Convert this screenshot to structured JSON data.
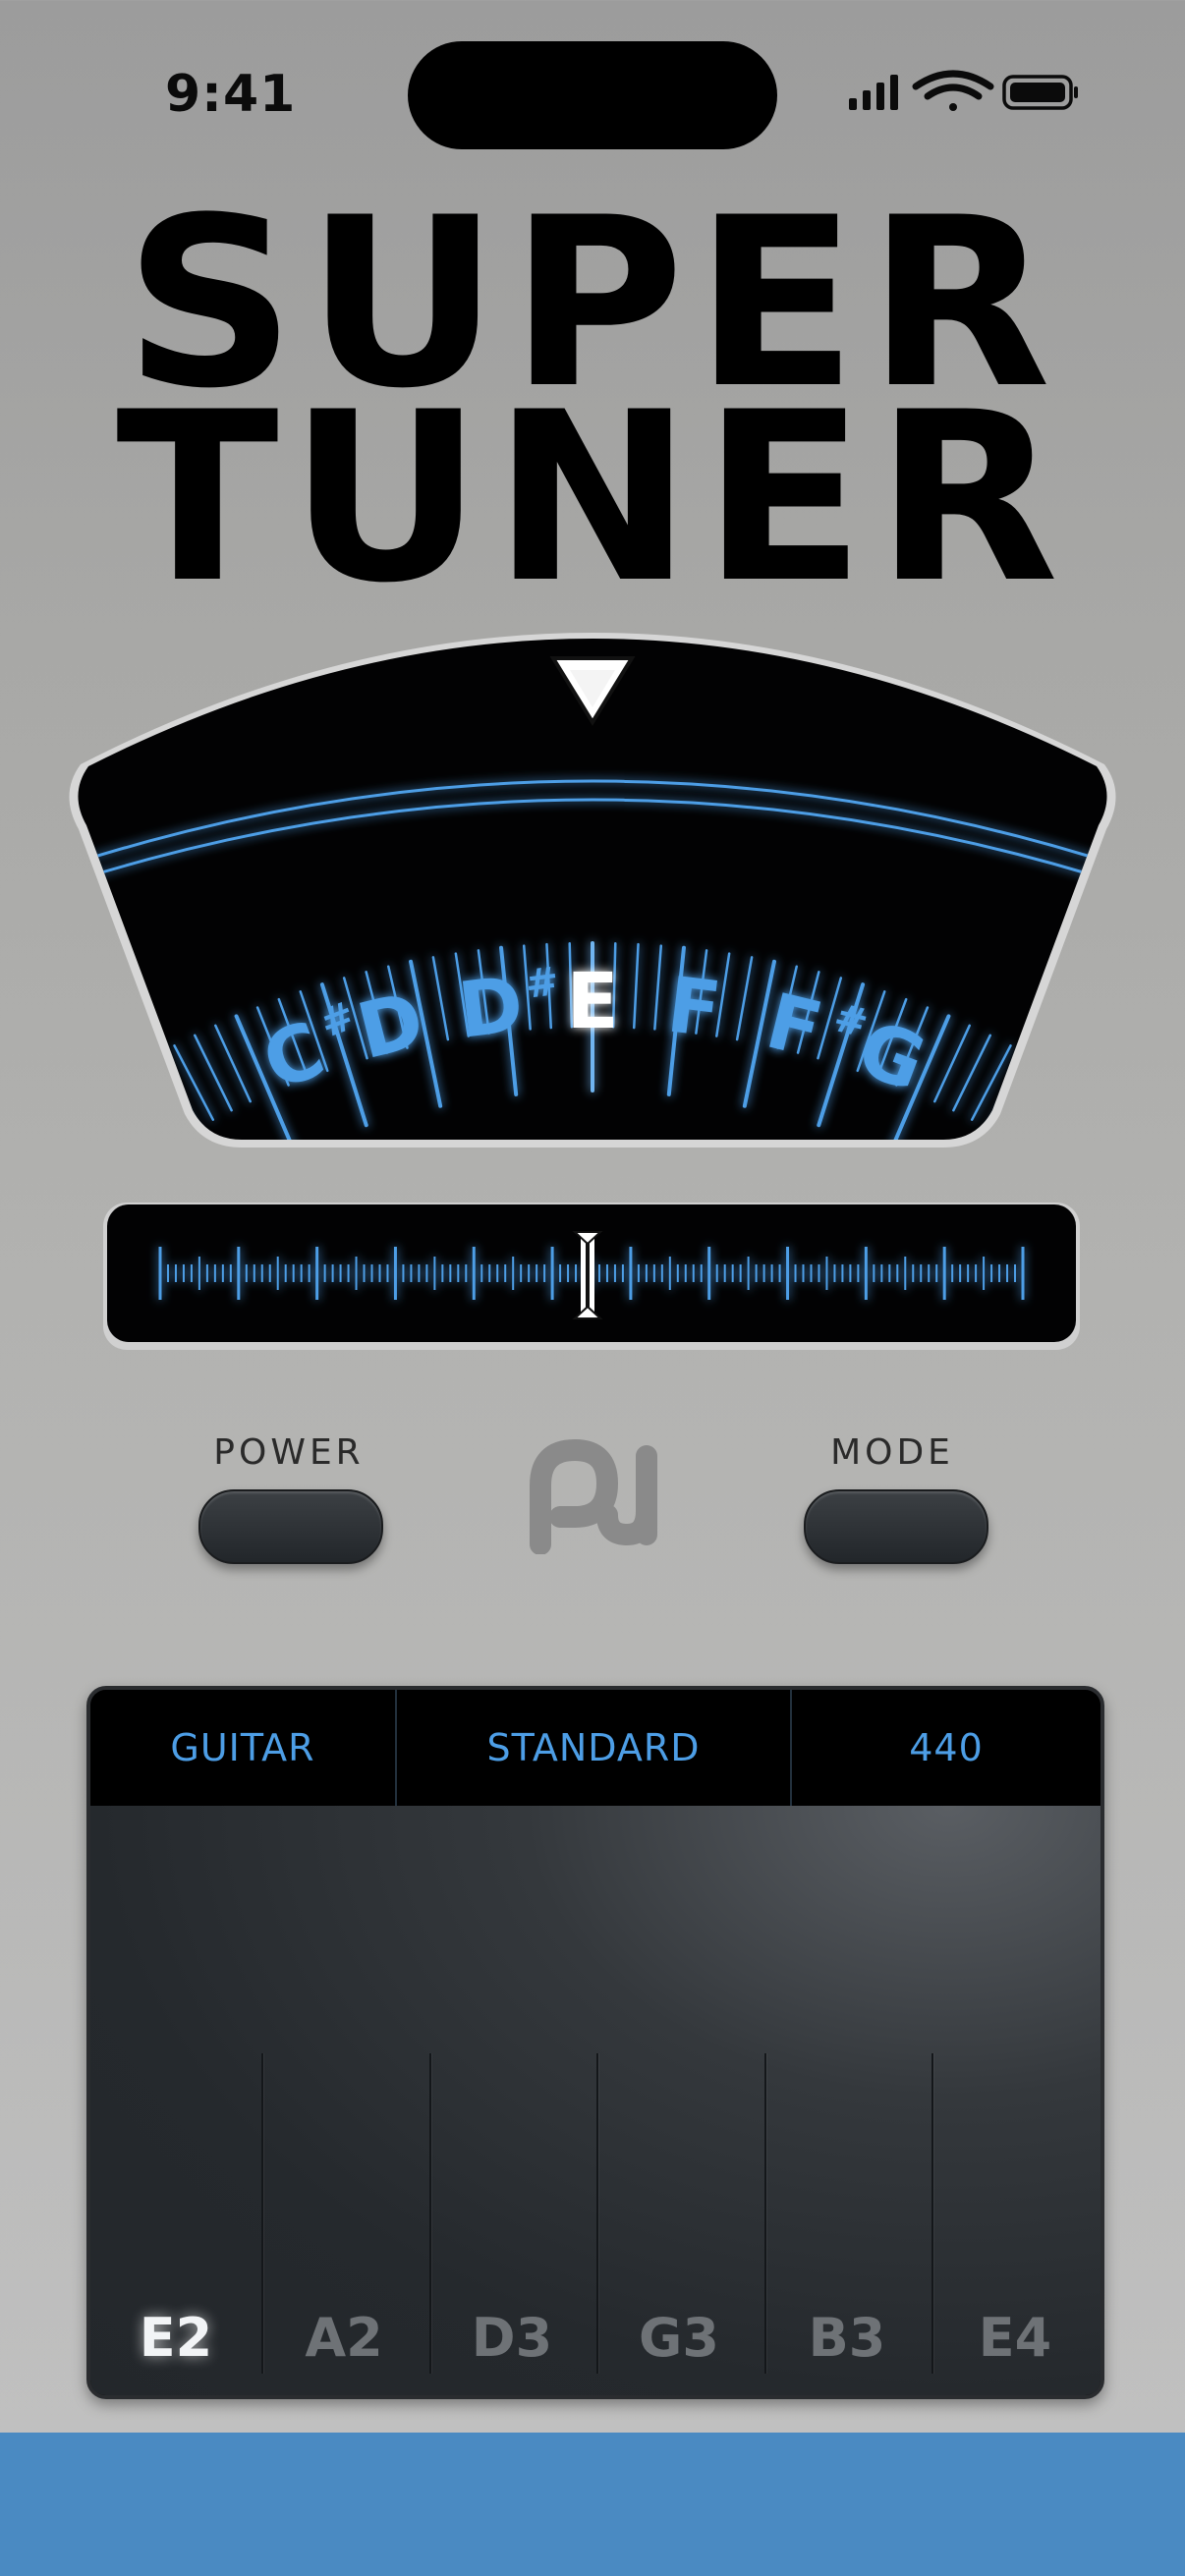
{
  "status_bar": {
    "time": "9:41"
  },
  "app": {
    "title_line1": "SUPER",
    "title_line2": "TUNER"
  },
  "meter": {
    "notes": [
      {
        "name": "C",
        "accidental": "#"
      },
      {
        "name": "D",
        "accidental": ""
      },
      {
        "name": "D",
        "accidental": "#"
      },
      {
        "name": "E",
        "accidental": ""
      },
      {
        "name": "F",
        "accidental": ""
      },
      {
        "name": "F",
        "accidental": "#"
      },
      {
        "name": "G",
        "accidental": ""
      }
    ],
    "active_note": "E",
    "accent_color": "#4d9ee6"
  },
  "fine_strip": {
    "needle_position": 0.5
  },
  "controls": {
    "power_label": "POWER",
    "mode_label": "MODE"
  },
  "tuning_panel": {
    "tabs": [
      "GUITAR",
      "STANDARD",
      "440"
    ],
    "strings": [
      "E2",
      "A2",
      "D3",
      "G3",
      "B3",
      "E4"
    ],
    "selected_string": "E2"
  },
  "colors": {
    "accent": "#4d9ee6",
    "bottom_bar": "#4a8ac2",
    "panel_bg": "#23272b"
  }
}
